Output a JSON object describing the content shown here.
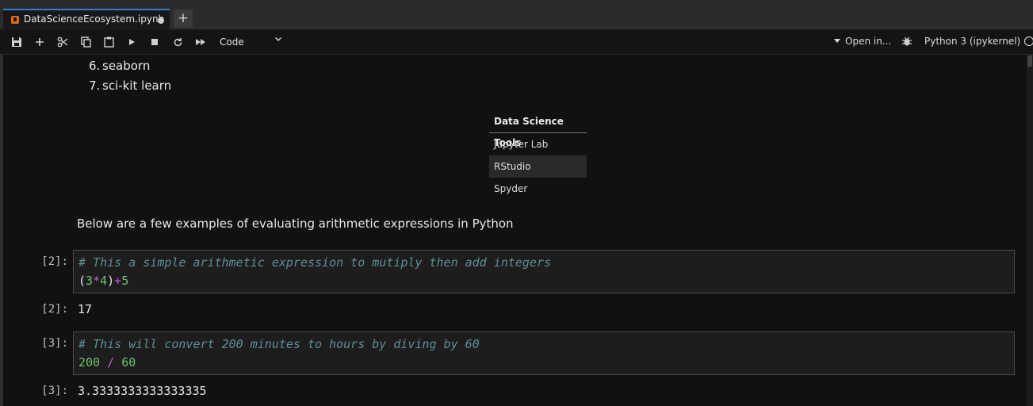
{
  "tab": {
    "title": "DataScienceEcosystem.ipynb",
    "new_tab_label": "+"
  },
  "toolbar": {
    "cell_type": "Code",
    "open_in": "Open in...",
    "kernel": "Python 3 (ipykernel)",
    "icons": [
      "save-icon",
      "add-icon",
      "cut-icon",
      "copy-icon",
      "paste-icon",
      "run-icon",
      "stop-icon",
      "restart-icon",
      "fast-forward-icon"
    ]
  },
  "markdown": {
    "list": [
      {
        "num": "6.",
        "text": "seaborn"
      },
      {
        "num": "7.",
        "text": "sci-kit learn"
      }
    ],
    "table": {
      "header": "Data Science Tools",
      "rows": [
        "Jupyter Lab",
        "RStudio",
        "Spyder"
      ]
    },
    "paragraph": "Below are a few examples of evaluating arithmetic expressions in Python"
  },
  "cells": [
    {
      "prompt": "[2]:",
      "comment": "# This a simple arithmetic expression to mutiply then add integers",
      "code_parts": [
        "(",
        "3",
        "*",
        "4",
        ")",
        "+",
        "5"
      ],
      "output_prompt": "[2]:",
      "output": "17"
    },
    {
      "prompt": "[3]:",
      "comment": "# This will convert 200 minutes to hours by diving by 60",
      "code_parts": [
        "200",
        " / ",
        "60"
      ],
      "output_prompt": "[3]:",
      "output": "3.3333333333333335"
    }
  ],
  "colors": {
    "accent": "#2f7fd7",
    "comment": "#5f8f94",
    "number": "#6ec26e",
    "operator": "#c35bd6"
  }
}
